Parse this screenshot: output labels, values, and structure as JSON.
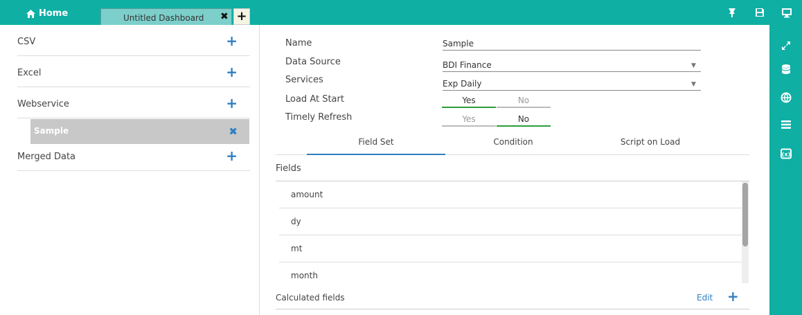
{
  "topbar": {
    "home_label": "Home",
    "tab_title": "Untitled Dashboard",
    "tab_close": "✖",
    "add_tab": "+",
    "icons": [
      "pin-icon",
      "save-icon",
      "monitor-icon"
    ]
  },
  "sidebar": {
    "items": [
      {
        "label": "CSV",
        "action": "+"
      },
      {
        "label": "Excel",
        "action": "+"
      },
      {
        "label": "Webservice",
        "action": "+"
      },
      {
        "label": "Merged Data",
        "action": "+"
      }
    ],
    "selected": {
      "label": "Sample",
      "action": "✖"
    }
  },
  "form": {
    "name_label": "Name",
    "name_value": "Sample",
    "datasource_label": "Data Source",
    "datasource_value": "BDI Finance",
    "services_label": "Services",
    "services_value": "Exp Daily",
    "load_label": "Load At Start",
    "refresh_label": "Timely Refresh",
    "yes": "Yes",
    "no": "No",
    "load_at_start": "Yes",
    "timely_refresh": "No"
  },
  "tabs": [
    "Field Set",
    "Condition",
    "Script on Load"
  ],
  "active_tab": "Field Set",
  "fields": {
    "label": "Fields",
    "items": [
      "amount",
      "dy",
      "mt",
      "month"
    ]
  },
  "calculated": {
    "label": "Calculated fields",
    "edit": "Edit",
    "add": "+"
  },
  "rail_icons": [
    "expand-icon",
    "database-icon",
    "globe-icon",
    "list-icon",
    "variable-icon"
  ],
  "colors": {
    "accent": "#0fafa4",
    "link": "#2f7fc1",
    "toggle_on": "#2e9c3b"
  }
}
